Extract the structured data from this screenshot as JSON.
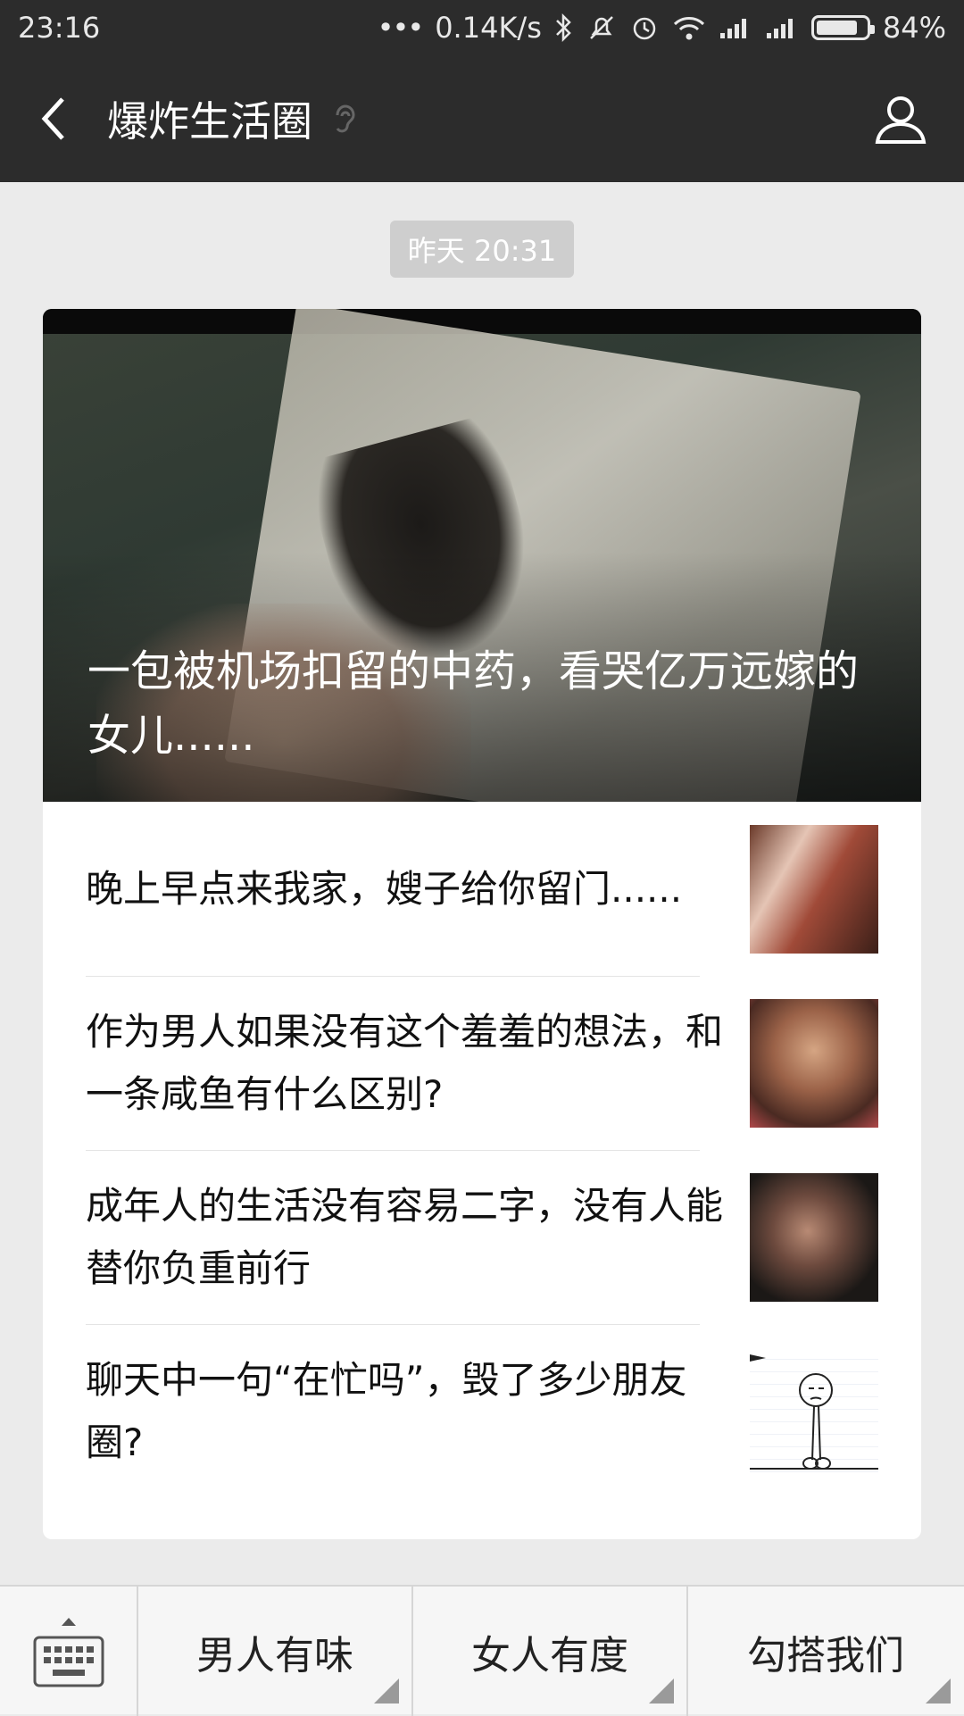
{
  "status_bar": {
    "time": "23:16",
    "dots": "•••",
    "net_speed": "0.14K/s",
    "battery_text": "84%",
    "battery_level": 0.84,
    "icons": [
      "bluetooth-icon",
      "mute-icon",
      "alarm-icon",
      "wifi-icon",
      "signal-icon",
      "signal-icon",
      "battery-icon"
    ]
  },
  "header": {
    "title": "爆炸生活圈",
    "back_icon": "chevron-left-icon",
    "profile_icon": "person-icon",
    "status_icon": "ear-icon"
  },
  "timestamp": "昨天 20:31",
  "article": {
    "hero_title": "一包被机场扣留的中药，看哭亿万远嫁的女儿......",
    "items": [
      {
        "title": "晚上早点来我家，嫂子给你留门......"
      },
      {
        "title": "作为男人如果没有这个羞羞的想法，和一条咸鱼有什么区别?"
      },
      {
        "title": "成年人的生活没有容易二字，没有人能替你负重前行"
      },
      {
        "title": "聊天中一句“在忙吗”，毁了多少朋友圈?"
      }
    ]
  },
  "bottom_menu": {
    "keyboard_icon": "keyboard-icon",
    "items": [
      {
        "label": "男人有味"
      },
      {
        "label": "女人有度"
      },
      {
        "label": "勾搭我们"
      }
    ]
  }
}
